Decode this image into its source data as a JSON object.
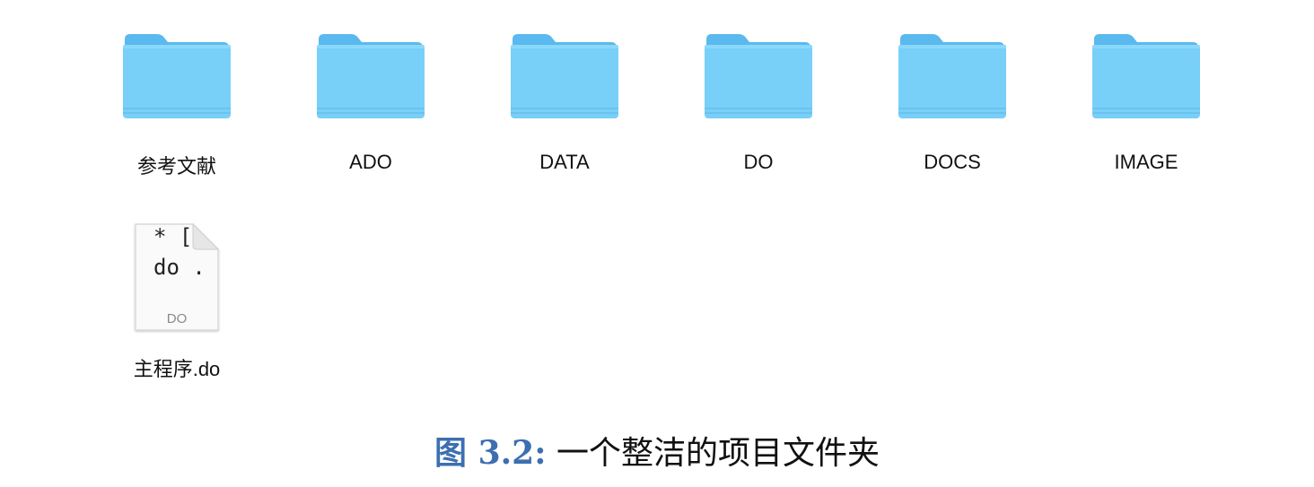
{
  "items": [
    {
      "label": "参考文献",
      "type": "folder"
    },
    {
      "label": "ADO",
      "type": "folder"
    },
    {
      "label": "DATA",
      "type": "folder"
    },
    {
      "label": "DO",
      "type": "folder"
    },
    {
      "label": "DOCS",
      "type": "folder"
    },
    {
      "label": "IMAGE",
      "type": "folder"
    }
  ],
  "file": {
    "label": "主程序.do",
    "preview_line1": "* [",
    "preview_line2": "do .",
    "badge": "DO",
    "icon": "stata-do-file-icon"
  },
  "folder_icon": "folder-icon",
  "colors": {
    "folder_front": "#78cff8",
    "folder_back": "#5ab9ee",
    "caption_prefix": "#3d6fb0"
  },
  "caption": {
    "prefix": "图 3.2:",
    "text": "一个整洁的项目文件夹"
  }
}
